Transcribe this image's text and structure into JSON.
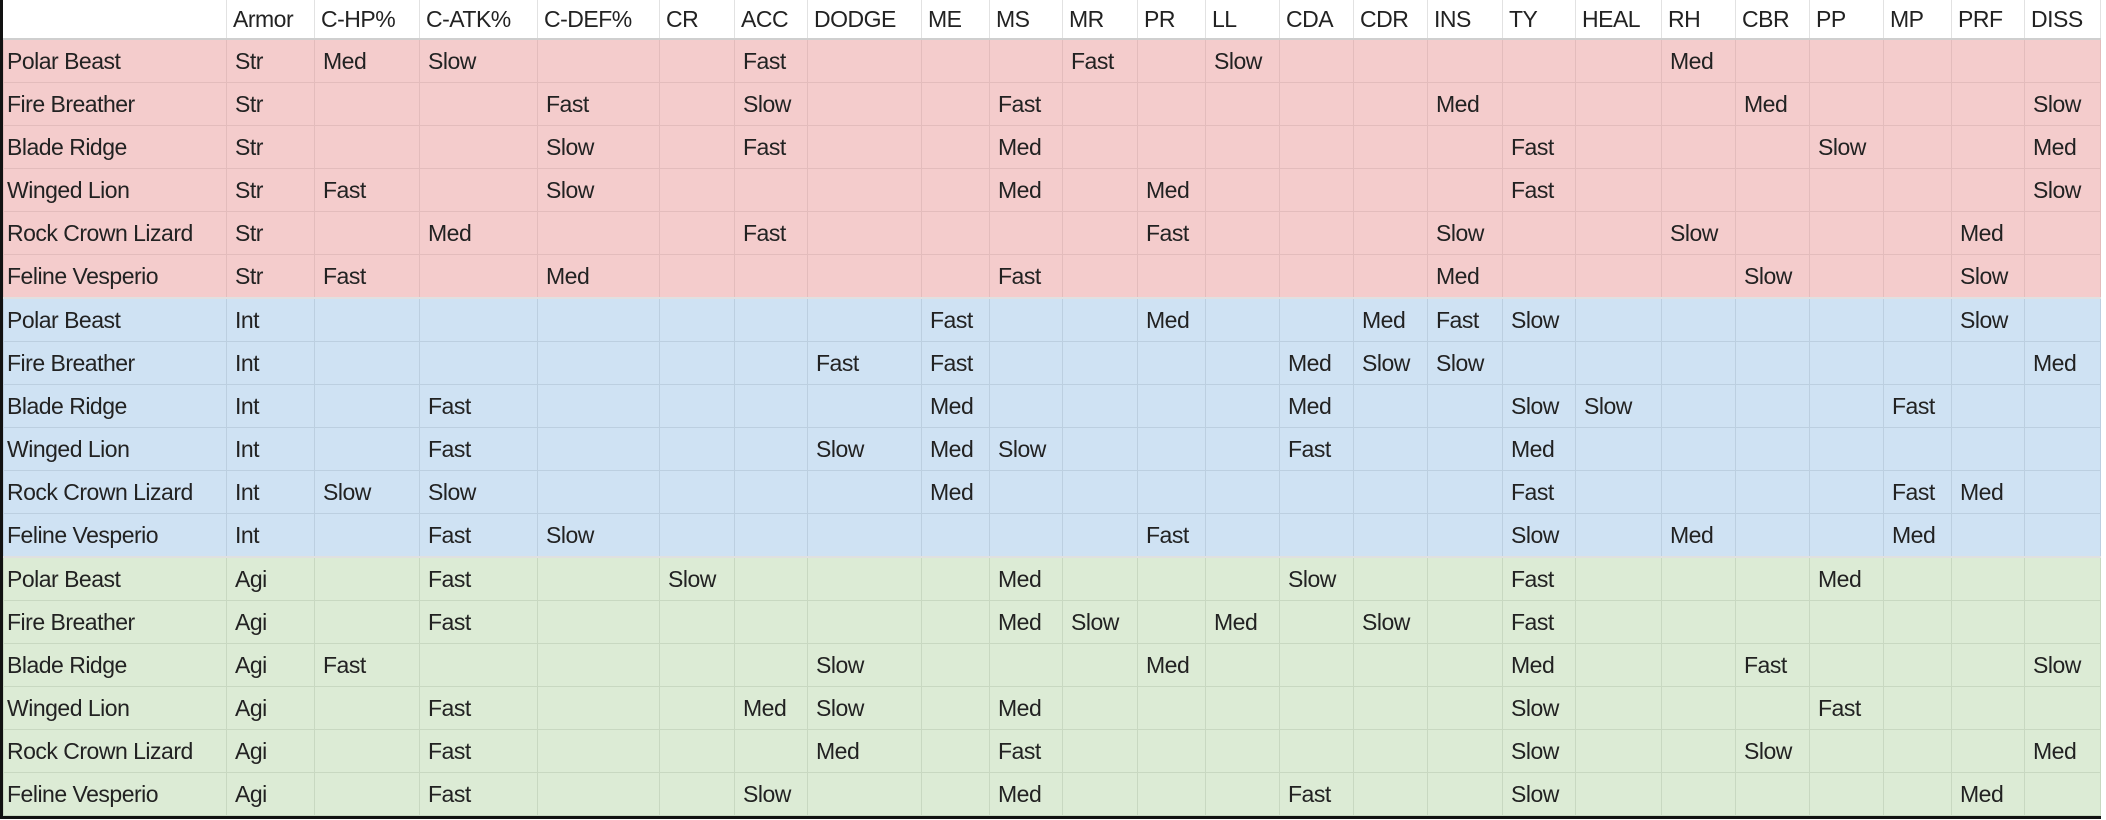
{
  "colors": {
    "Str": "#f4cccc",
    "Int": "#cfe2f3",
    "Agi": "#dcebd5"
  },
  "columns": [
    "",
    "Armor",
    "C-HP%",
    "C-ATK%",
    "C-DEF%",
    "CR",
    "ACC",
    "DODGE",
    "ME",
    "MS",
    "MR",
    "PR",
    "LL",
    "CDA",
    "CDR",
    "INS",
    "TY",
    "HEAL",
    "RH",
    "CBR",
    "PP",
    "MP",
    "PRF",
    "DISS"
  ],
  "rows": [
    [
      "Polar Beast",
      "Str",
      "Med",
      "Slow",
      "",
      "",
      "Fast",
      "",
      "",
      "",
      "Fast",
      "",
      "Slow",
      "",
      "",
      "",
      "",
      "",
      "Med",
      "",
      "",
      "",
      "",
      ""
    ],
    [
      "Fire Breather",
      "Str",
      "",
      "",
      "Fast",
      "",
      "Slow",
      "",
      "",
      "Fast",
      "",
      "",
      "",
      "",
      "",
      "Med",
      "",
      "",
      "",
      "Med",
      "",
      "",
      "",
      "Slow"
    ],
    [
      "Blade Ridge",
      "Str",
      "",
      "",
      "Slow",
      "",
      "Fast",
      "",
      "",
      "Med",
      "",
      "",
      "",
      "",
      "",
      "",
      "Fast",
      "",
      "",
      "",
      "Slow",
      "",
      "",
      "Med"
    ],
    [
      "Winged Lion",
      "Str",
      "Fast",
      "",
      "Slow",
      "",
      "",
      "",
      "",
      "Med",
      "",
      "Med",
      "",
      "",
      "",
      "",
      "Fast",
      "",
      "",
      "",
      "",
      "",
      "",
      "Slow"
    ],
    [
      "Rock Crown Lizard",
      "Str",
      "",
      "Med",
      "",
      "",
      "Fast",
      "",
      "",
      "",
      "",
      "Fast",
      "",
      "",
      "",
      "Slow",
      "",
      "",
      "Slow",
      "",
      "",
      "",
      "Med",
      ""
    ],
    [
      "Feline Vesperio",
      "Str",
      "Fast",
      "",
      "Med",
      "",
      "",
      "",
      "",
      "Fast",
      "",
      "",
      "",
      "",
      "",
      "Med",
      "",
      "",
      "",
      "Slow",
      "",
      "",
      "Slow",
      ""
    ],
    [
      "Polar Beast",
      "Int",
      "",
      "",
      "",
      "",
      "",
      "",
      "Fast",
      "",
      "",
      "Med",
      "",
      "",
      "Med",
      "Fast",
      "Slow",
      "",
      "",
      "",
      "",
      "",
      "Slow",
      ""
    ],
    [
      "Fire Breather",
      "Int",
      "",
      "",
      "",
      "",
      "",
      "Fast",
      "Fast",
      "",
      "",
      "",
      "",
      "Med",
      "Slow",
      "Slow",
      "",
      "",
      "",
      "",
      "",
      "",
      "",
      "Med"
    ],
    [
      "Blade Ridge",
      "Int",
      "",
      "Fast",
      "",
      "",
      "",
      "",
      "Med",
      "",
      "",
      "",
      "",
      "Med",
      "",
      "",
      "Slow",
      "Slow",
      "",
      "",
      "",
      "Fast",
      "",
      ""
    ],
    [
      "Winged Lion",
      "Int",
      "",
      "Fast",
      "",
      "",
      "",
      "Slow",
      "Med",
      "Slow",
      "",
      "",
      "",
      "Fast",
      "",
      "",
      "Med",
      "",
      "",
      "",
      "",
      "",
      "",
      ""
    ],
    [
      "Rock Crown Lizard",
      "Int",
      "Slow",
      "Slow",
      "",
      "",
      "",
      "",
      "Med",
      "",
      "",
      "",
      "",
      "",
      "",
      "",
      "Fast",
      "",
      "",
      "",
      "",
      "Fast",
      "Med",
      ""
    ],
    [
      "Feline Vesperio",
      "Int",
      "",
      "Fast",
      "Slow",
      "",
      "",
      "",
      "",
      "",
      "",
      "Fast",
      "",
      "",
      "",
      "",
      "Slow",
      "",
      "Med",
      "",
      "",
      "Med",
      "",
      ""
    ],
    [
      "Polar Beast",
      "Agi",
      "",
      "Fast",
      "",
      "Slow",
      "",
      "",
      "",
      "Med",
      "",
      "",
      "",
      "Slow",
      "",
      "",
      "Fast",
      "",
      "",
      "",
      "Med",
      "",
      "",
      ""
    ],
    [
      "Fire Breather",
      "Agi",
      "",
      "Fast",
      "",
      "",
      "",
      "",
      "",
      "Med",
      "Slow",
      "",
      "Med",
      "",
      "Slow",
      "",
      "Fast",
      "",
      "",
      "",
      "",
      "",
      "",
      ""
    ],
    [
      "Blade Ridge",
      "Agi",
      "Fast",
      "",
      "",
      "",
      "",
      "Slow",
      "",
      "",
      "",
      "Med",
      "",
      "",
      "",
      "",
      "Med",
      "",
      "",
      "Fast",
      "",
      "",
      "",
      "Slow"
    ],
    [
      "Winged Lion",
      "Agi",
      "",
      "Fast",
      "",
      "",
      "Med",
      "Slow",
      "",
      "Med",
      "",
      "",
      "",
      "",
      "",
      "",
      "Slow",
      "",
      "",
      "",
      "Fast",
      "",
      "",
      ""
    ],
    [
      "Rock Crown Lizard",
      "Agi",
      "",
      "Fast",
      "",
      "",
      "",
      "Med",
      "",
      "Fast",
      "",
      "",
      "",
      "",
      "",
      "",
      "Slow",
      "",
      "",
      "Slow",
      "",
      "",
      "",
      "Med"
    ],
    [
      "Feline Vesperio",
      "Agi",
      "",
      "Fast",
      "",
      "",
      "Slow",
      "",
      "",
      "Med",
      "",
      "",
      "",
      "Fast",
      "",
      "",
      "Slow",
      "",
      "",
      "",
      "",
      "",
      "Med",
      ""
    ]
  ]
}
